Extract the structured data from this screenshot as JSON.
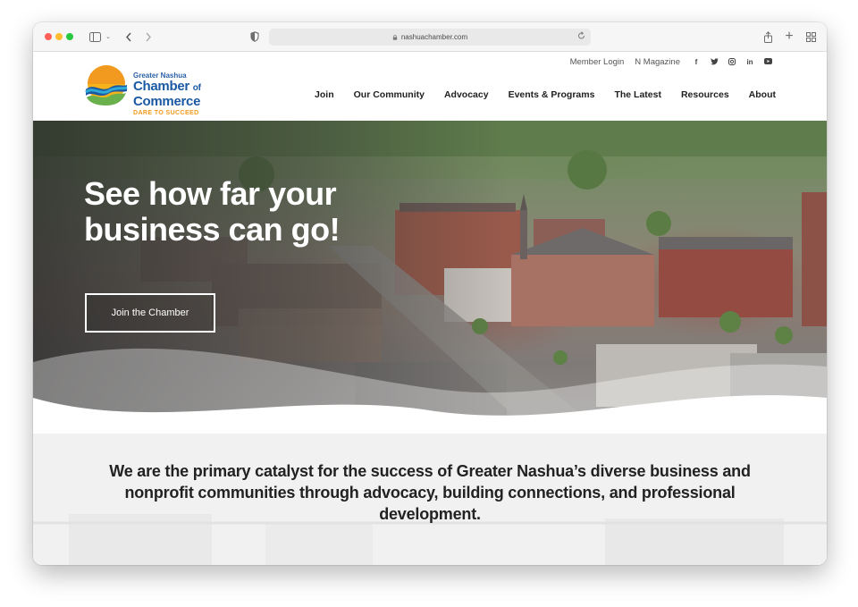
{
  "browser": {
    "url": "nashuachamber.com"
  },
  "logo": {
    "line1": "Greater Nashua",
    "line2": "Chamber",
    "line2_suffix": "of",
    "line3": "Commerce",
    "tagline": "DARE TO SUCCEED"
  },
  "utility": {
    "member_login": "Member Login",
    "magazine": "N Magazine",
    "social": [
      {
        "icon": "facebook-icon",
        "glyph": "f"
      },
      {
        "icon": "twitter-icon",
        "glyph": "t"
      },
      {
        "icon": "instagram-icon",
        "glyph": "◎"
      },
      {
        "icon": "linkedin-icon",
        "glyph": "in"
      },
      {
        "icon": "youtube-icon",
        "glyph": "▶"
      }
    ]
  },
  "nav": {
    "items": [
      "Join",
      "Our Community",
      "Advocacy",
      "Events & Programs",
      "The Latest",
      "Resources",
      "About"
    ]
  },
  "hero": {
    "title": "See how far your business can go!",
    "button": "Join the Chamber"
  },
  "mission": {
    "text": "We are the primary catalyst for the success of Greater Nashua’s diverse business and nonprofit communities through advocacy, building connections, and professional development."
  },
  "colors": {
    "brand_blue": "#1b5aa3",
    "brand_orange": "#f29a1f",
    "brand_green": "#6ab04c"
  }
}
